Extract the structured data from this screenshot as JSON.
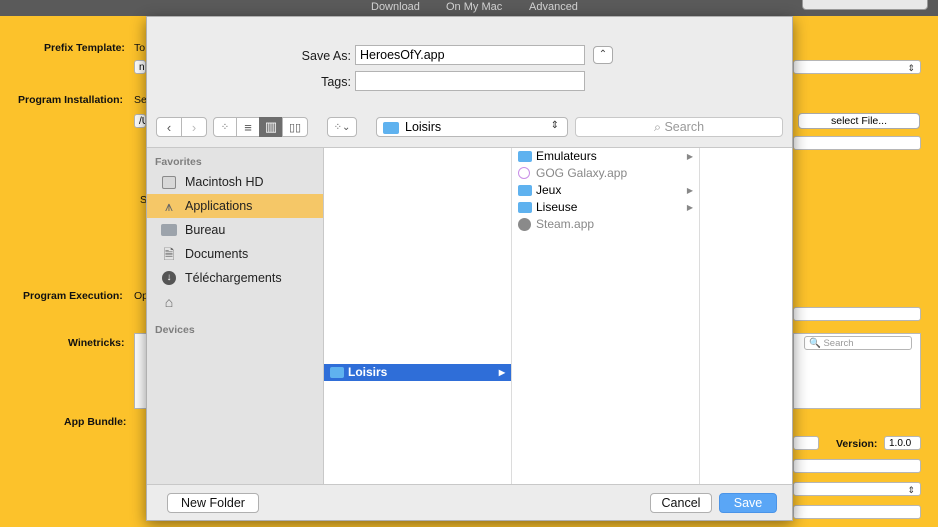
{
  "topbar": {
    "tabs": [
      "Download",
      "On My Mac",
      "Advanced"
    ]
  },
  "background_app": {
    "labels": {
      "prefix_template": "Prefix Template:",
      "program_installation": "Program Installation:",
      "program_execution": "Program Execution:",
      "winetricks": "Winetricks:",
      "app_bundle": "App Bundle:",
      "version": "Version:"
    },
    "fragments": {
      "prefix_template": "To",
      "prefix_dropdown": "n",
      "program_installation": "Se",
      "install_path": "/U",
      "s_label": "S",
      "program_execution": "Op"
    },
    "select_file_button": "select File...",
    "winetricks_search_placeholder": "Search",
    "version_value": "1.0.0",
    "colors": {
      "background": "#fcc22b"
    }
  },
  "dialog": {
    "save_as_label": "Save As:",
    "save_as_value": "HeroesOfY.app",
    "tags_label": "Tags:",
    "tags_value": "",
    "location_popup": "Loisirs",
    "search_placeholder": "Search",
    "sidebar": {
      "favorites_header": "Favorites",
      "items": [
        {
          "label": "Macintosh HD",
          "icon": "hard-drive-icon"
        },
        {
          "label": "Applications",
          "icon": "applications-icon",
          "selected": true
        },
        {
          "label": "Bureau",
          "icon": "desktop-folder-icon"
        },
        {
          "label": "Documents",
          "icon": "documents-icon"
        },
        {
          "label": "Téléchargements",
          "icon": "downloads-icon"
        },
        {
          "label": "",
          "icon": "home-icon"
        }
      ],
      "devices_header": "Devices"
    },
    "column1": [
      {
        "name": "Loisirs",
        "kind": "folder",
        "selected": true,
        "has_children": true
      }
    ],
    "column2": [
      {
        "name": "Emulateurs",
        "kind": "folder",
        "has_children": true
      },
      {
        "name": "GOG Galaxy.app",
        "kind": "app",
        "dimmed": true
      },
      {
        "name": "Jeux",
        "kind": "folder",
        "has_children": true
      },
      {
        "name": "Liseuse",
        "kind": "folder",
        "has_children": true
      },
      {
        "name": "Steam.app",
        "kind": "app",
        "dimmed": true
      }
    ],
    "new_folder_button": "New Folder",
    "cancel_button": "Cancel",
    "save_button": "Save",
    "colors": {
      "selection": "#2f6ed8",
      "sidebar_selection": "#f5c767",
      "primary": "#5aa6f6"
    }
  }
}
